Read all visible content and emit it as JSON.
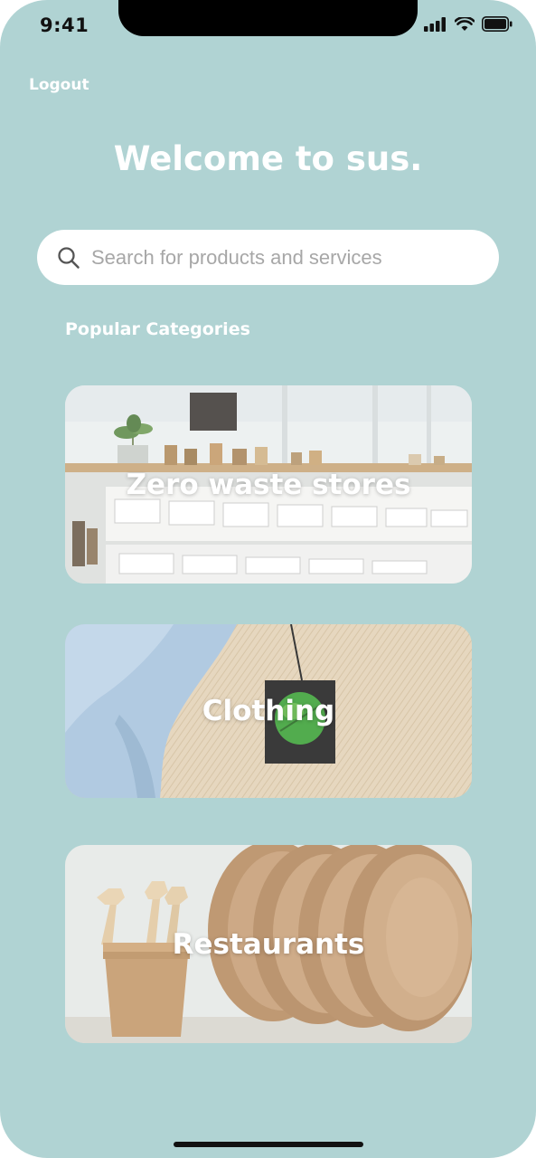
{
  "status_bar": {
    "time": "9:41"
  },
  "header": {
    "logout_label": "Logout",
    "welcome_title": "Welcome to sus."
  },
  "search": {
    "placeholder": "Search for products and services"
  },
  "categories_section": {
    "title": "Popular Categories",
    "items": [
      {
        "label": "Zero waste stores"
      },
      {
        "label": "Clothing"
      },
      {
        "label": "Restaurants"
      }
    ]
  },
  "theme": {
    "background": "#b0d3d3",
    "text": "#ffffff"
  }
}
